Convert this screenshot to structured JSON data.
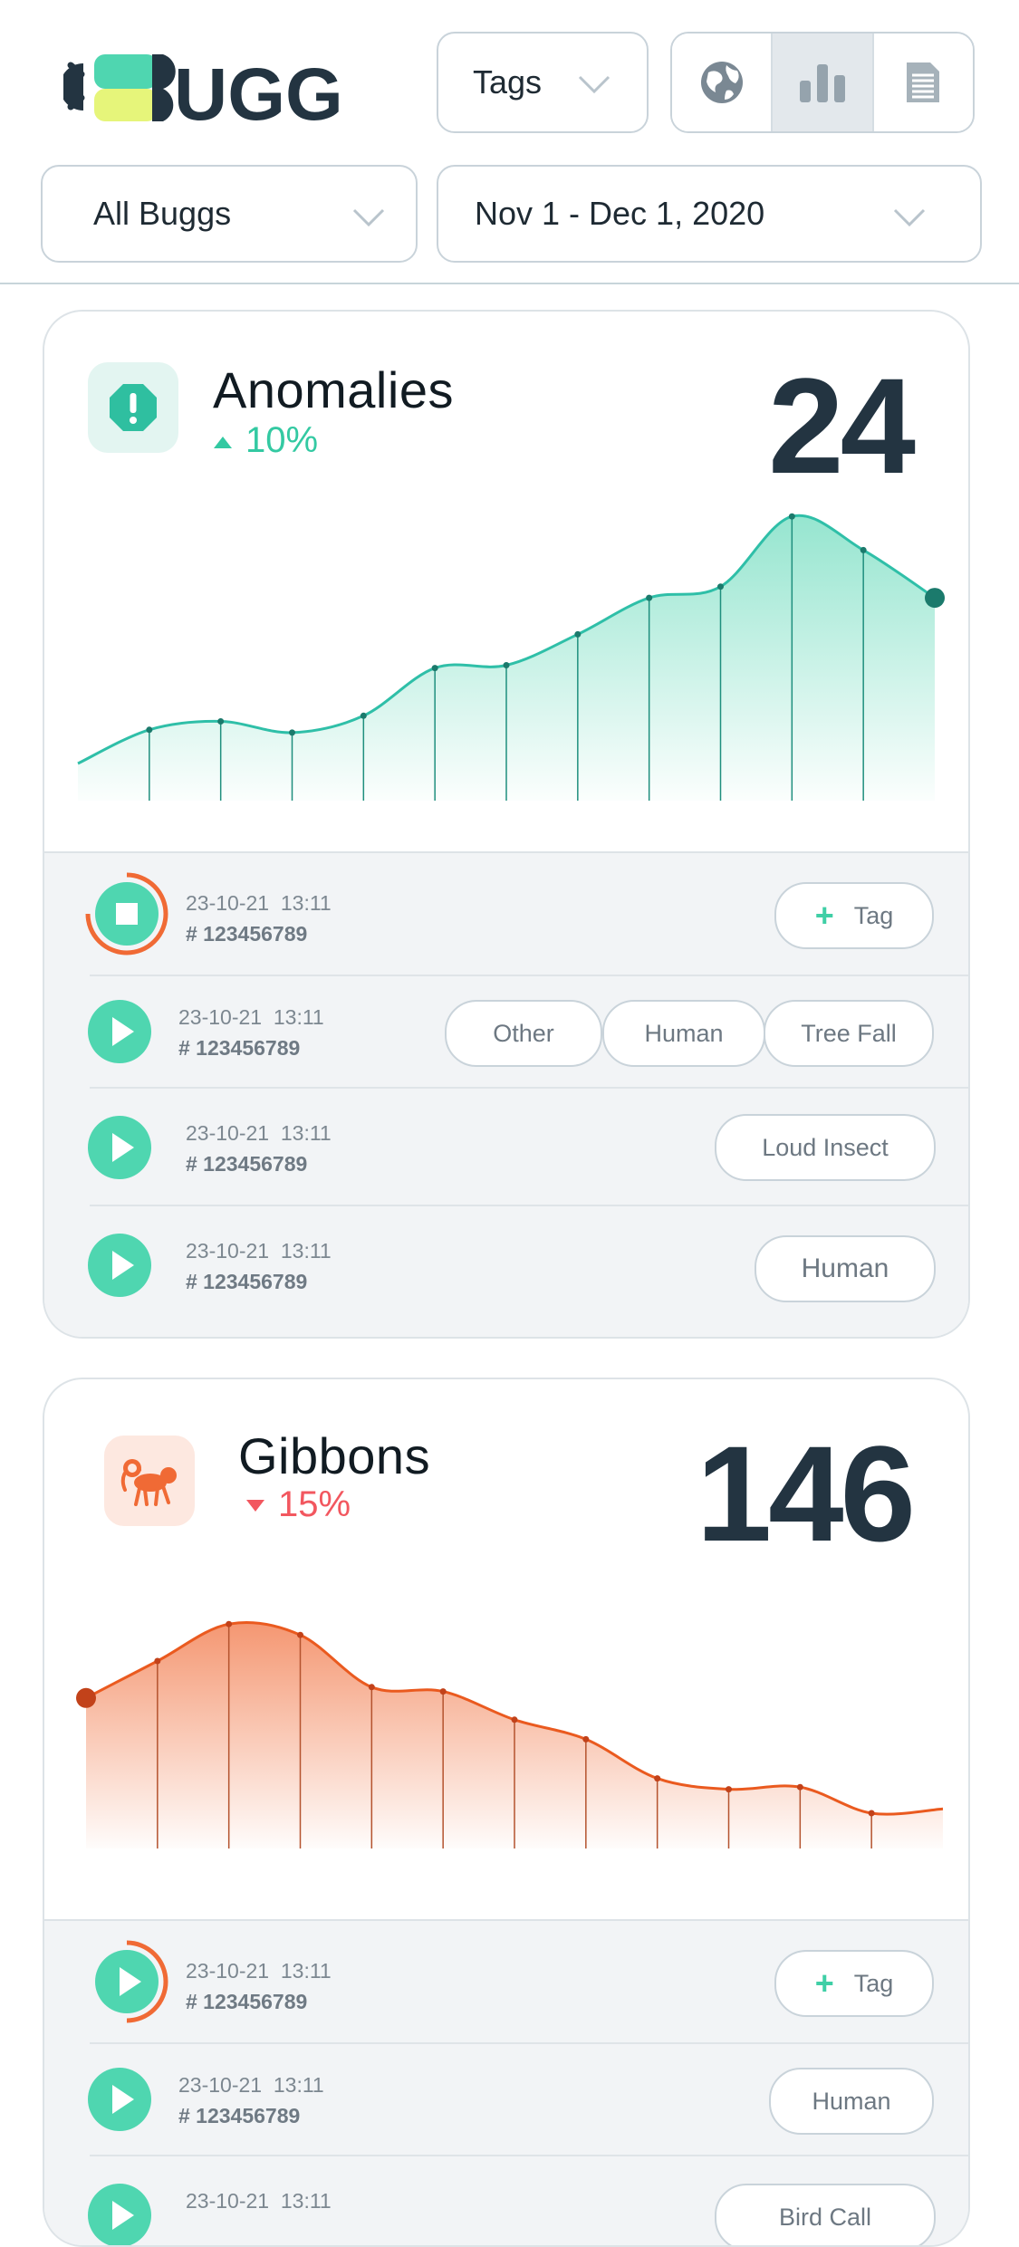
{
  "brand": {
    "name_text": "UGG"
  },
  "header": {
    "tags_label": "Tags",
    "filter_label": "All Buggs",
    "date_range": "Nov 1 - Dec 1, 2020",
    "views": [
      {
        "icon": "globe-icon",
        "active": false
      },
      {
        "icon": "bar-chart-icon",
        "active": true
      },
      {
        "icon": "document-icon",
        "active": false
      }
    ]
  },
  "colors": {
    "teal": "#3fcfa6",
    "orange": "#f06a35",
    "dark": "#233441"
  },
  "cards": [
    {
      "title": "Anomalies",
      "count": "24",
      "change": "10%",
      "trend": "up",
      "icon": "alert-icon",
      "chart_data": {
        "type": "area",
        "values": [
          0.1,
          0.22,
          0.25,
          0.21,
          0.27,
          0.44,
          0.45,
          0.56,
          0.69,
          0.73,
          0.98,
          0.86,
          0.69
        ]
      },
      "recordings": [
        {
          "date": "23-10-21",
          "time": "13:11",
          "id": "# 123456789",
          "tags": [],
          "add_tag": "Tag",
          "playing": true
        },
        {
          "date": "23-10-21",
          "time": "13:11",
          "id": "# 123456789",
          "tags": [
            "Other",
            "Human",
            "Tree Fall"
          ]
        },
        {
          "date": "23-10-21",
          "time": "13:11",
          "id": "# 123456789",
          "tags": [
            "Loud Insect"
          ]
        },
        {
          "date": "23-10-21",
          "time": "13:11",
          "id": "# 123456789",
          "tags": [
            "Human"
          ]
        }
      ]
    },
    {
      "title": "Gibbons",
      "count": "146",
      "change": "15%",
      "trend": "down",
      "icon": "monkey-icon",
      "chart_data": {
        "type": "area",
        "values": [
          0.63,
          0.8,
          0.97,
          0.92,
          0.68,
          0.66,
          0.53,
          0.44,
          0.26,
          0.21,
          0.22,
          0.1,
          0.12
        ]
      },
      "recordings": [
        {
          "date": "23-10-21",
          "time": "13:11",
          "id": "# 123456789",
          "tags": [],
          "add_tag": "Tag",
          "playing": true
        },
        {
          "date": "23-10-21",
          "time": "13:11",
          "id": "# 123456789",
          "tags": [
            "Human"
          ]
        },
        {
          "date": "23-10-21",
          "time": "13:11",
          "id": "",
          "tags": [
            "Bird Call"
          ]
        }
      ]
    }
  ]
}
